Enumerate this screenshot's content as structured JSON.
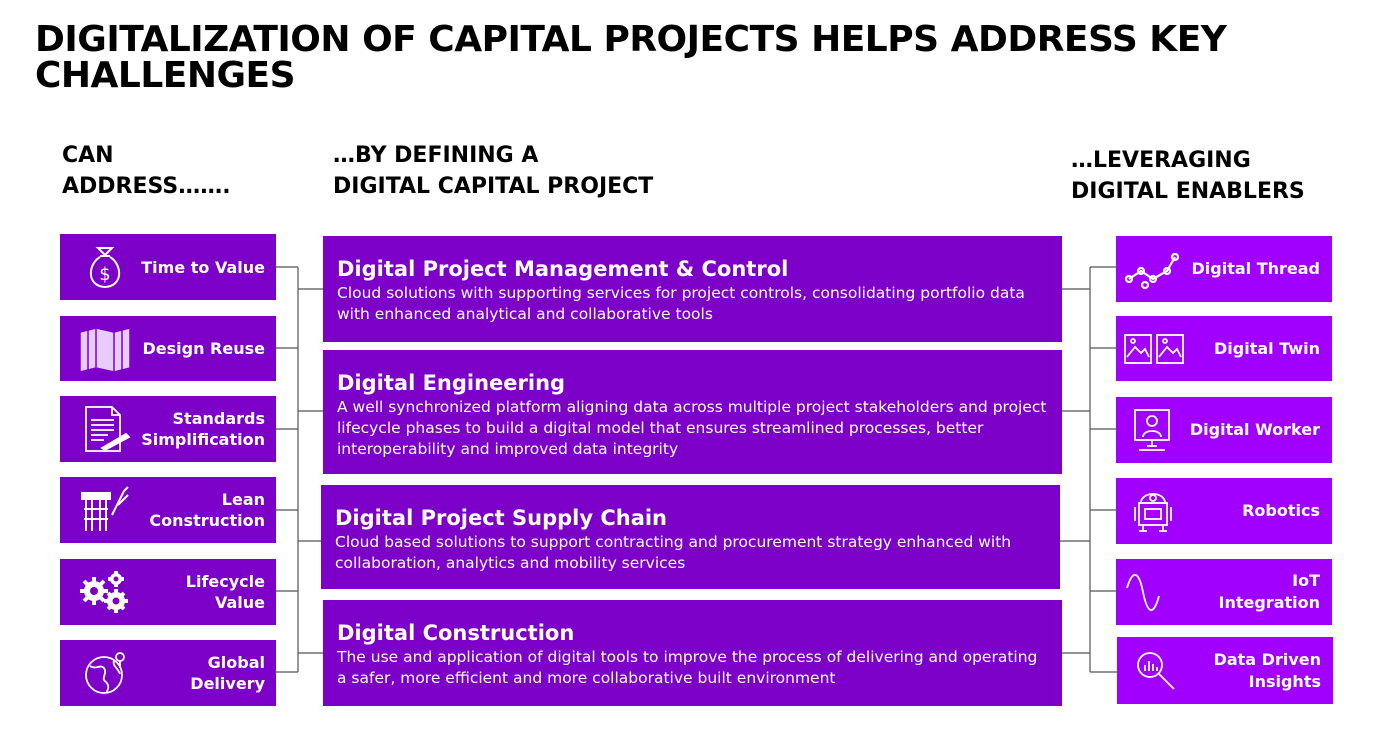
{
  "title": "DIGITALIZATION OF CAPITAL PROJECTS HELPS ADDRESS KEY CHALLENGES",
  "columns": {
    "left_heading": "CAN\nADDRESS…….",
    "middle_heading": "…BY DEFINING A\nDIGITAL CAPITAL PROJECT",
    "right_heading": "…LEVERAGING\nDIGITAL ENABLERS"
  },
  "challenges": [
    {
      "label": "Time to Value",
      "icon": "money-bag-icon"
    },
    {
      "label": "Design Reuse",
      "icon": "map-icon"
    },
    {
      "label": "Standards\nSimplification",
      "icon": "document-pen-icon"
    },
    {
      "label": "Lean\nConstruction",
      "icon": "construction-icon"
    },
    {
      "label": "Lifecycle\nValue",
      "icon": "gears-icon"
    },
    {
      "label": "Global\nDelivery",
      "icon": "globe-icon"
    }
  ],
  "pillars": [
    {
      "title": "Digital Project Management & Control",
      "description": "Cloud solutions with supporting services for project controls, consolidating portfolio data with enhanced analytical and collaborative tools"
    },
    {
      "title": "Digital Engineering",
      "description": "A well synchronized platform aligning data across multiple project stakeholders and project lifecycle phases to build a digital model  that ensures streamlined processes, better interoperability and improved data integrity"
    },
    {
      "title": "Digital Project Supply Chain",
      "description": "Cloud based solutions to support contracting and procurement strategy enhanced with collaboration, analytics and mobility services"
    },
    {
      "title": "Digital Construction",
      "description": "The use and application of digital tools to improve the process of delivering and operating a safer, more efficient and more collaborative built environment"
    }
  ],
  "enablers": [
    {
      "label": "Digital Thread",
      "icon": "thread-nodes-icon"
    },
    {
      "label": "Digital Twin",
      "icon": "twin-images-icon"
    },
    {
      "label": "Digital Worker",
      "icon": "worker-monitor-icon"
    },
    {
      "label": "Robotics",
      "icon": "robot-icon"
    },
    {
      "label": "IoT Integration",
      "icon": "wave-signal-icon"
    },
    {
      "label": "Data Driven\nInsights",
      "icon": "magnifier-chart-icon"
    }
  ],
  "colors": {
    "left_box": "#7c00c8",
    "middle_box": "#7c00c8",
    "right_box": "#a100ff",
    "connector": "#555555"
  }
}
